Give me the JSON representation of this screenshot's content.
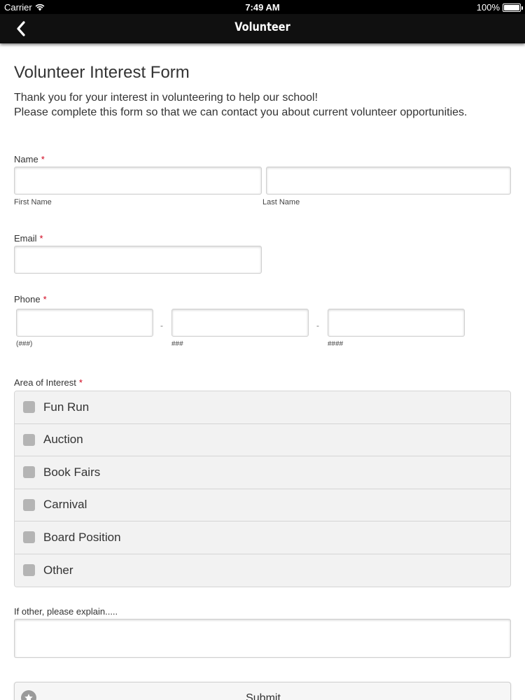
{
  "status_bar": {
    "carrier": "Carrier",
    "time": "7:49 AM",
    "battery": "100%",
    "battery_level": 1.0
  },
  "navbar": {
    "title": "Volunteer",
    "back_icon": "chevron-left-icon"
  },
  "form": {
    "title": "Volunteer Interest Form",
    "intro_line1": "Thank you for your interest in volunteering to help our school!",
    "intro_line2": "Please complete this form so that we can contact you about current volunteer opportunities.",
    "required_marker": "*",
    "name": {
      "label": "Name",
      "first_sublabel": "First Name",
      "last_sublabel": "Last Name",
      "first_value": "",
      "last_value": ""
    },
    "email": {
      "label": "Email",
      "value": ""
    },
    "phone": {
      "label": "Phone",
      "separator": "-",
      "area_hint": "(###)",
      "prefix_hint": "###",
      "line_hint": "####"
    },
    "interest": {
      "label": "Area of Interest",
      "options": [
        {
          "label": "Fun Run",
          "checked": false
        },
        {
          "label": "Auction",
          "checked": false
        },
        {
          "label": "Book Fairs",
          "checked": false
        },
        {
          "label": "Carnival",
          "checked": false
        },
        {
          "label": "Board Position",
          "checked": false
        },
        {
          "label": "Other",
          "checked": false
        }
      ]
    },
    "other": {
      "label": "If other, please explain.....",
      "value": ""
    },
    "submit": {
      "label": "Submit",
      "icon": "star-icon"
    }
  },
  "colors": {
    "nav_background": "#101010",
    "required": "#d0021b",
    "checkbox": "#b4b4b4",
    "list_background": "#f2f2f2"
  }
}
